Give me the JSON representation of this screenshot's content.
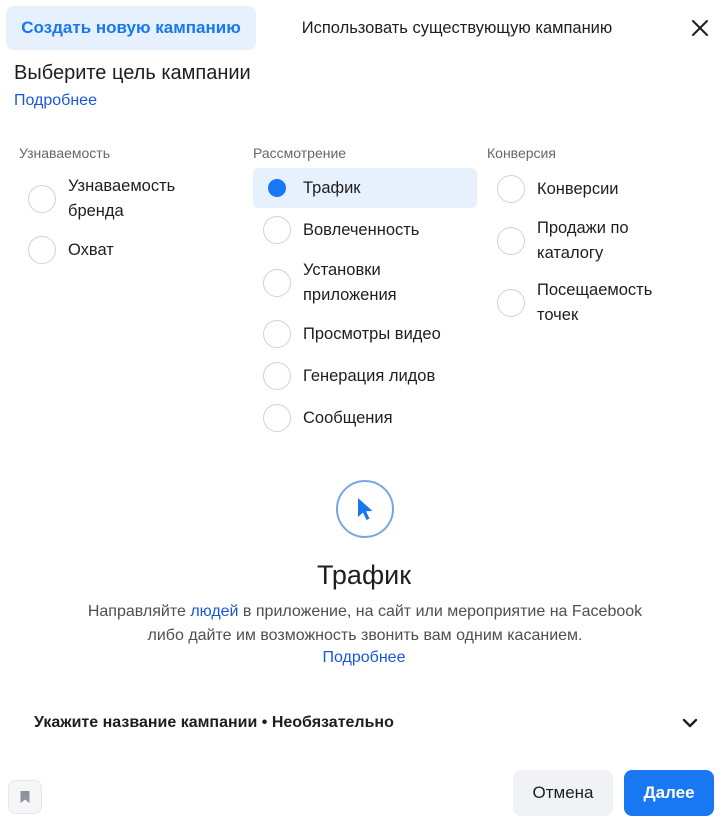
{
  "tabs": {
    "active": "Создать новую кампанию",
    "inactive": "Использовать существующую кампанию"
  },
  "heading": "Выберите цель кампании",
  "learn_more": "Подробнее",
  "columns": [
    {
      "title": "Узнаваемость",
      "options": [
        {
          "label": "Узнаваемость бренда",
          "selected": false
        },
        {
          "label": "Охват",
          "selected": false
        }
      ]
    },
    {
      "title": "Рассмотрение",
      "options": [
        {
          "label": "Трафик",
          "selected": true
        },
        {
          "label": "Вовлеченность",
          "selected": false
        },
        {
          "label": "Установки приложения",
          "selected": false
        },
        {
          "label": "Просмотры видео",
          "selected": false
        },
        {
          "label": "Генерация лидов",
          "selected": false
        },
        {
          "label": "Сообщения",
          "selected": false
        }
      ]
    },
    {
      "title": "Конверсия",
      "options": [
        {
          "label": "Конверсии",
          "selected": false
        },
        {
          "label": "Продажи по каталогу",
          "selected": false
        },
        {
          "label": "Посещаемость точек",
          "selected": false
        }
      ]
    }
  ],
  "detail": {
    "icon": "cursor-icon",
    "title": "Трафик",
    "desc_before": "Направляйте ",
    "desc_link": "людей",
    "desc_after": " в приложение, на сайт или мероприятие на Facebook либо дайте им возможность звонить вам одним касанием.",
    "learn_more": "Подробнее"
  },
  "campaign_name": {
    "label": "Укажите название кампании • Необязательно"
  },
  "footer": {
    "cancel": "Отмена",
    "next": "Далее"
  },
  "colors": {
    "accent": "#1877f2",
    "link": "#1a56db",
    "selected_bg": "#e7f0fd"
  }
}
